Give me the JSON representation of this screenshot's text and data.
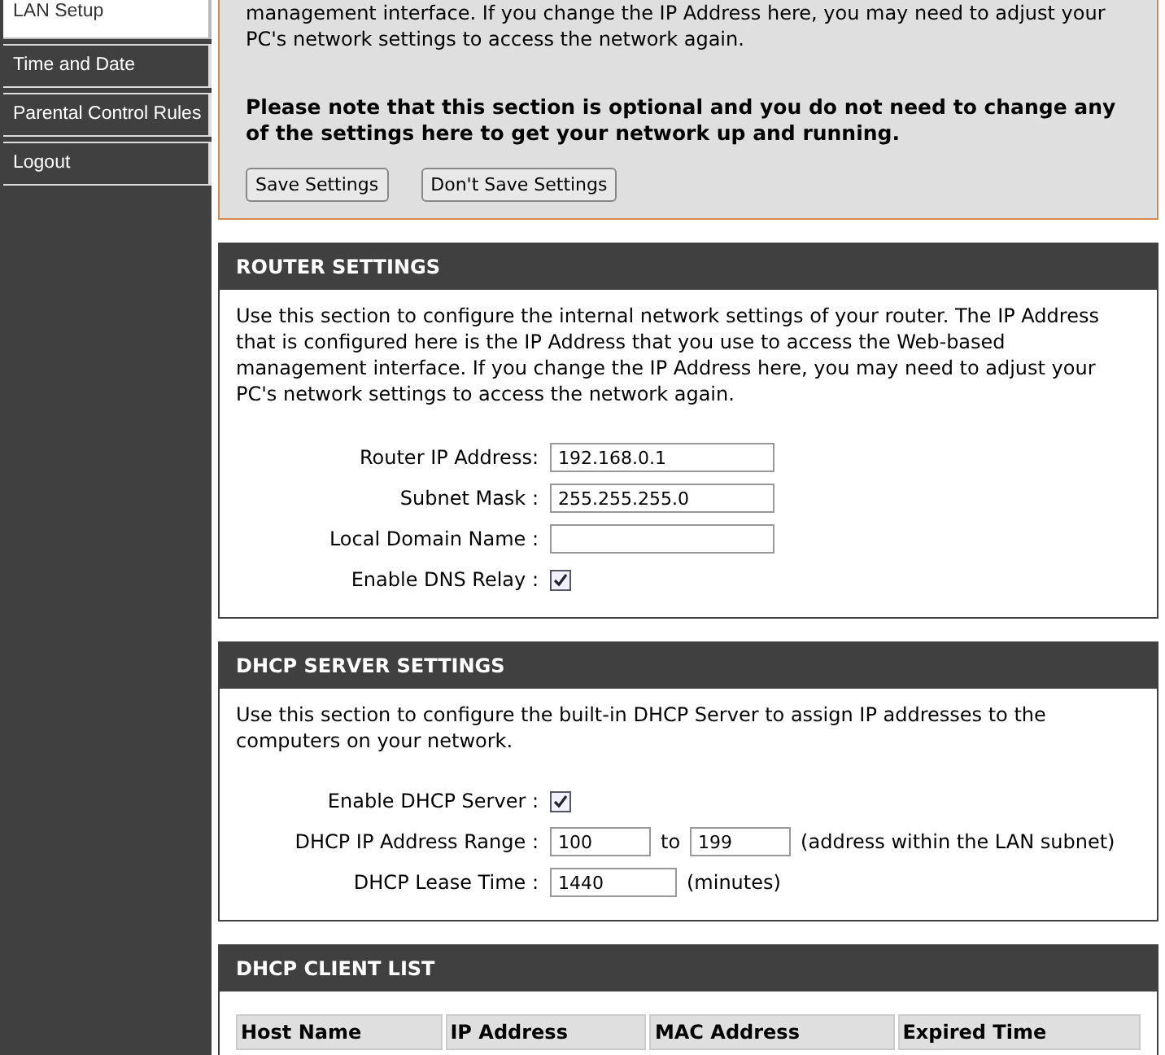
{
  "sidebar": {
    "items": [
      {
        "label": "LAN Setup",
        "selected": true
      },
      {
        "label": "Time and Date",
        "selected": false
      },
      {
        "label": "Parental Control Rules",
        "selected": false
      },
      {
        "label": "Logout",
        "selected": false
      }
    ]
  },
  "intro": {
    "text": "management interface. If you change the IP Address here, you may need to adjust your PC's network settings to access the network again.",
    "note": "Please note that this section is optional and you do not need to change any of the settings here to get your network up and running.",
    "buttons": [
      "Save Settings",
      "Don't Save Settings"
    ]
  },
  "router_settings": {
    "title": "ROUTER SETTINGS",
    "description": "Use this section to configure the internal network settings of your router. The IP Address that is configured here is the IP Address that you use to access the Web-based management interface. If you change the IP Address here, you may need to adjust your PC's network settings to access the network again.",
    "fields": [
      {
        "kind": "text",
        "label": "Router IP Address:",
        "value": "192.168.0.1"
      },
      {
        "kind": "text",
        "label": "Subnet Mask :",
        "value": "255.255.255.0"
      },
      {
        "kind": "text",
        "label": "Local Domain Name :"
      },
      {
        "kind": "checkbox",
        "label": "Enable DNS Relay :",
        "checked": true
      }
    ]
  },
  "dhcp_server_settings": {
    "title": "DHCP SERVER SETTINGS",
    "description": "Use this section to configure the built-in DHCP Server to assign IP addresses to the computers on your network.",
    "fields": [
      {
        "kind": "checkbox",
        "label": "Enable DHCP Server :",
        "checked": true
      },
      {
        "kind": "range",
        "label": "DHCP IP Address Range :",
        "from": "100",
        "separator": "to",
        "to": "199",
        "hint": "(address within the LAN subnet)"
      },
      {
        "kind": "text",
        "label": "DHCP Lease Time :",
        "value": "1440",
        "hint": "(minutes)"
      }
    ]
  },
  "dhcp_client_list": {
    "title": "DHCP CLIENT LIST",
    "columns": [
      "Host Name",
      "IP Address",
      "MAC Address",
      "Expired Time"
    ]
  }
}
